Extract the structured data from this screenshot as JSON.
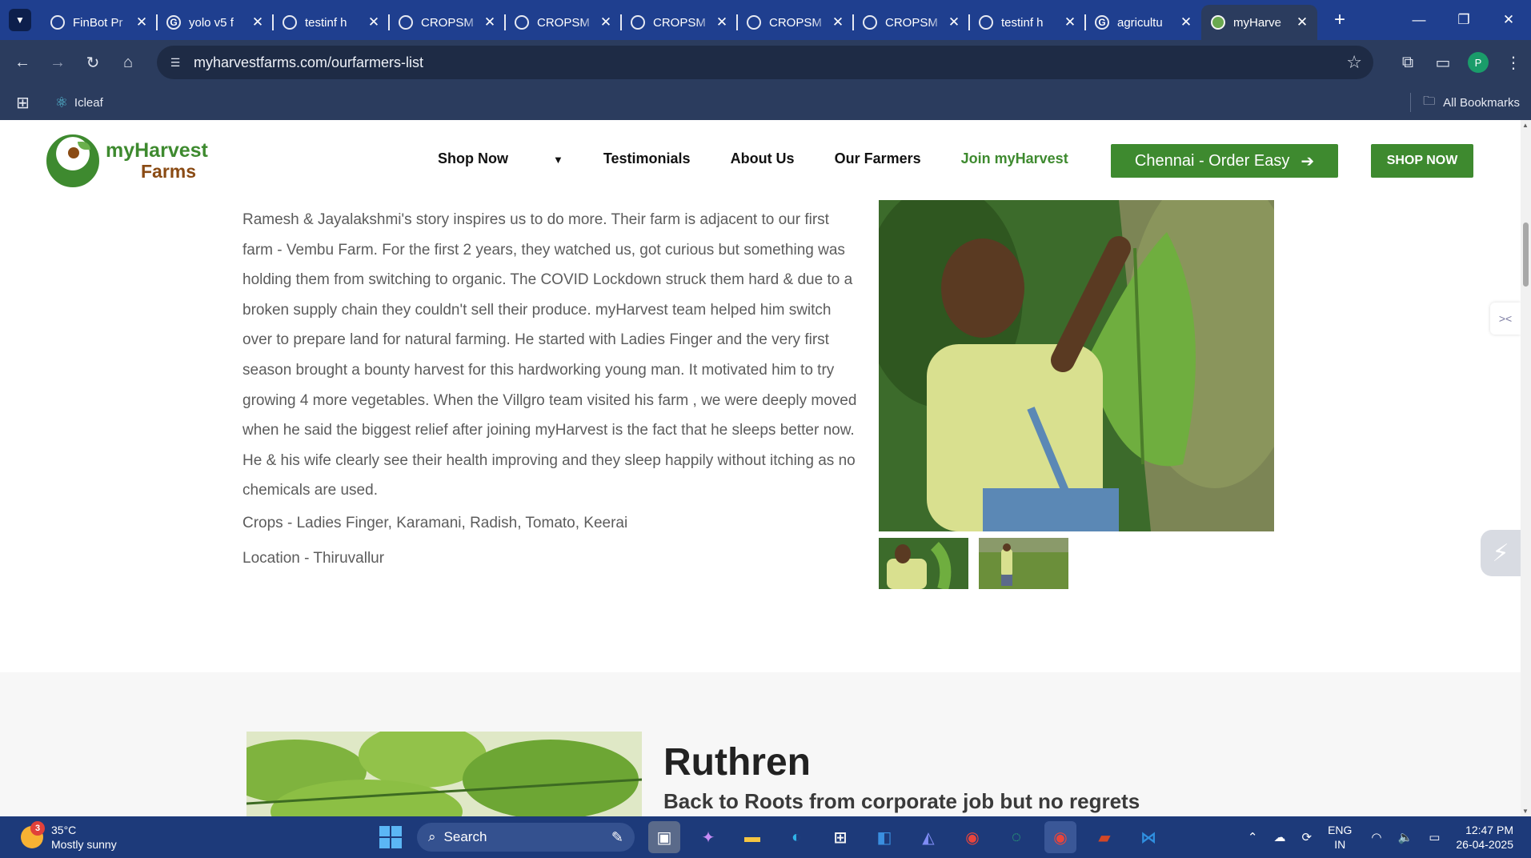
{
  "browser": {
    "tabs": [
      {
        "title": "FinBot Pr",
        "icon": "gear-favicon"
      },
      {
        "title": "yolo v5 f",
        "icon": "google-favicon"
      },
      {
        "title": "testinf h",
        "icon": "globe-favicon"
      },
      {
        "title": "CROPSM",
        "icon": "globe-favicon"
      },
      {
        "title": "CROPSM",
        "icon": "globe-favicon"
      },
      {
        "title": "CROPSM",
        "icon": "globe-favicon"
      },
      {
        "title": "CROPSM",
        "icon": "globe-favicon"
      },
      {
        "title": "CROPSM",
        "icon": "globe-favicon"
      },
      {
        "title": "testinf h",
        "icon": "globe-favicon"
      },
      {
        "title": "agricultu",
        "icon": "google-favicon"
      },
      {
        "title": "myHarve",
        "icon": "myharvest-favicon",
        "active": true
      }
    ],
    "url": "myharvestfarms.com/ourfarmers-list",
    "bookmarks": {
      "item": "Icleaf",
      "all": "All Bookmarks"
    },
    "profile_initial": "P"
  },
  "site": {
    "logo": {
      "line1": "myHarvest",
      "line2": "Farms"
    },
    "nav": {
      "shop_now": "Shop Now",
      "testimonials": "Testimonials",
      "about": "About Us",
      "farmers": "Our Farmers",
      "join": "Join myHarvest"
    },
    "cta_order": "Chennai - Order Easy",
    "cta_shop": "SHOP NOW",
    "accent": "#3e8a2f"
  },
  "farmer1": {
    "story": "Ramesh & Jayalakshmi's story inspires us to do more. Their farm is adjacent to our first farm - Vembu Farm. For the first 2 years, they watched us, got curious but something was holding them from switching to organic. The COVID Lockdown struck them hard & due to a broken supply chain they couldn't sell their produce. myHarvest team helped him switch over to prepare land for natural farming. He started with Ladies Finger and the very first season brought a bounty harvest for this hardworking young man. It motivated him to try growing 4 more vegetables. When the Villgro team visited his farm , we were deeply moved when he said the biggest relief after joining myHarvest is the fact that he sleeps better now. He & his wife clearly see their health improving and they sleep happily without itching as no chemicals are used.",
    "crops": "Crops - Ladies Finger, Karamani, Radish, Tomato, Keerai",
    "location": "Location - Thiruvallur"
  },
  "farmer2": {
    "name": "Ruthren",
    "tagline": "Back to Roots from corporate job but no regrets"
  },
  "taskbar": {
    "weather_badge": "3",
    "temperature": "35°C",
    "condition": "Mostly sunny",
    "search_label": "Search",
    "lang1": "ENG",
    "lang2": "IN",
    "time": "12:47 PM",
    "date": "26-04-2025"
  }
}
